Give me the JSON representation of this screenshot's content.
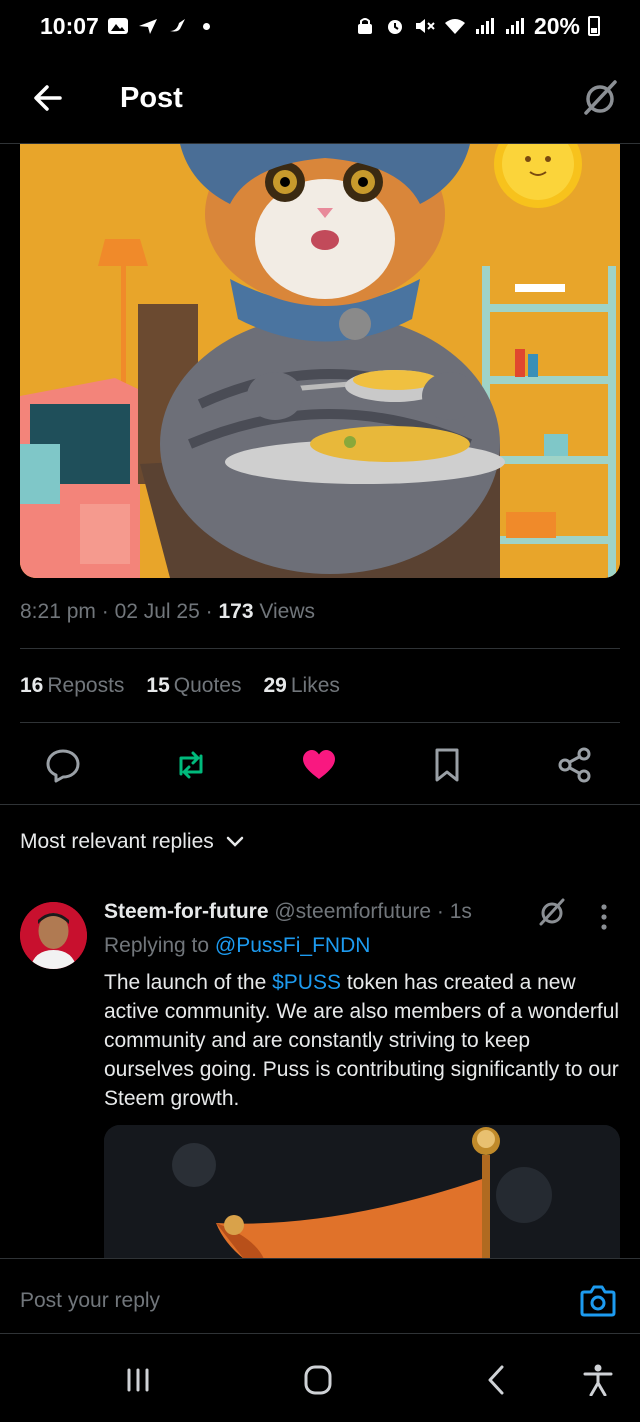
{
  "status_bar": {
    "time": "10:07",
    "battery": "20%"
  },
  "header": {
    "title": "Post"
  },
  "post": {
    "time": "8:21 pm",
    "date": "02 Jul 25",
    "views_count": "173",
    "views_label": "Views",
    "reposts_count": "16",
    "reposts_label": "Reposts",
    "quotes_count": "15",
    "quotes_label": "Quotes",
    "likes_count": "29",
    "likes_label": "Likes"
  },
  "replies_filter": {
    "label": "Most relevant replies"
  },
  "reply": {
    "name": "Steem-for-future",
    "handle": "@steemforfuture",
    "time": "1s",
    "replying_prefix": "Replying to",
    "replying_to": "@PussFi_FNDN",
    "text_before": "The launch of the ",
    "text_link": "$PUSS",
    "text_after": " token has created a new active community. We are also members of a wonderful community and are constantly striving to keep ourselves going. Puss is contributing significantly to our Steem growth."
  },
  "composer": {
    "placeholder": "Post your reply"
  },
  "colors": {
    "accent": "#1d9bf0",
    "like": "#f91880",
    "repost": "#00ba7c",
    "background": "#000000"
  }
}
